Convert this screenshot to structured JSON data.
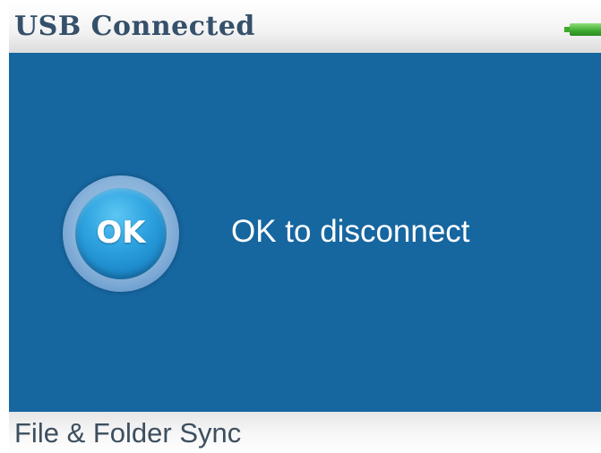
{
  "header": {
    "title": "USB Connected",
    "battery_icon": "battery-icon"
  },
  "main": {
    "ok_badge_label": "OK",
    "message": "OK to disconnect"
  },
  "footer": {
    "label": "File & Folder Sync"
  },
  "colors": {
    "main_background": "#1666a0",
    "header_title": "#35506a",
    "ok_button": "#2ea3e0",
    "battery": "#3ea82f"
  }
}
